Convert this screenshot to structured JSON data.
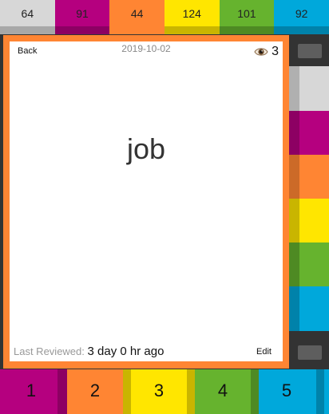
{
  "top_stats": {
    "counts": [
      "64",
      "91",
      "44",
      "124",
      "101",
      "92"
    ],
    "colors": [
      "#d7d7d7",
      "#b5007f",
      "#ff8533",
      "#ffe600",
      "#66b32e",
      "#00a8db"
    ],
    "under_colors": [
      "#a8a8a8",
      "#8d0063",
      "#cc6a28",
      "#c9b500",
      "#4e8a23",
      "#0082aa"
    ]
  },
  "card": {
    "back_label": "Back",
    "date": "2019-10-02",
    "view_icon": "eye-icon",
    "view_count": "3",
    "word": "job",
    "last_reviewed_label": "Last Reviewed:",
    "last_reviewed_value": "3 day 0 hr ago",
    "edit_label": "Edit",
    "frame_color": "#ff8533"
  },
  "rating_buttons": {
    "labels": [
      "1",
      "2",
      "3",
      "4",
      "5"
    ],
    "colors": [
      "#b5007f",
      "#ff8533",
      "#ffe600",
      "#66b32e",
      "#00a8db"
    ]
  }
}
